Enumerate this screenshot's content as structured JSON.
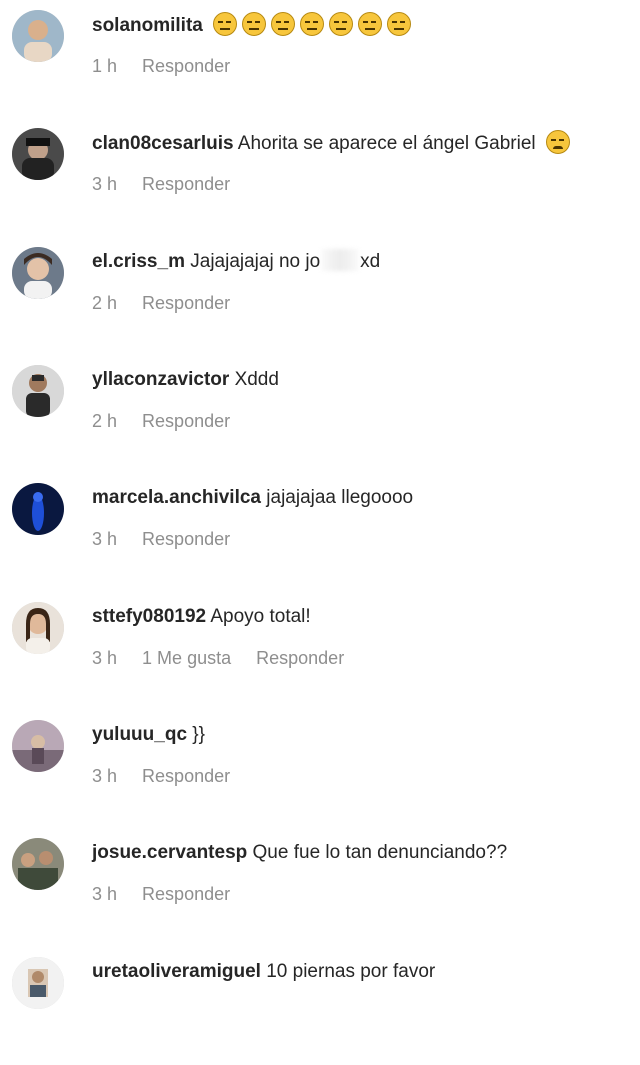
{
  "comments": [
    {
      "username": "solanomilita",
      "text": "",
      "emoji_count": 7,
      "time": "1 h",
      "likes": "",
      "reply": "Responder"
    },
    {
      "username": "clan08cesarluis",
      "text": "Ahorita se aparece el ángel Gabriel",
      "emoji_count": 1,
      "time": "3 h",
      "likes": "",
      "reply": "Responder"
    },
    {
      "username": "el.criss_m",
      "text": "Jajajajajaj no jo",
      "text_after": "xd",
      "time": "2 h",
      "likes": "",
      "reply": "Responder"
    },
    {
      "username": "yllaconzavictor",
      "text": "Xddd",
      "time": "2 h",
      "likes": "",
      "reply": "Responder"
    },
    {
      "username": "marcela.anchivilca",
      "text": "jajajajaa llegoooo",
      "time": "3 h",
      "likes": "",
      "reply": "Responder"
    },
    {
      "username": "sttefy080192",
      "text": "Apoyo total!",
      "time": "3 h",
      "likes": "1 Me gusta",
      "reply": "Responder"
    },
    {
      "username": "yuluuu_qc",
      "text": "}}",
      "time": "3 h",
      "likes": "",
      "reply": "Responder"
    },
    {
      "username": "josue.cervantesp",
      "text": "Que fue lo tan denunciando??",
      "time": "3 h",
      "likes": "",
      "reply": "Responder"
    },
    {
      "username": "uretaoliveramiguel",
      "text": "10 piernas por favor",
      "time": "",
      "likes": "",
      "reply": ""
    }
  ],
  "colors": {
    "username": "#262626",
    "meta": "#8e8e8e",
    "emoji": "#f7c63c"
  }
}
